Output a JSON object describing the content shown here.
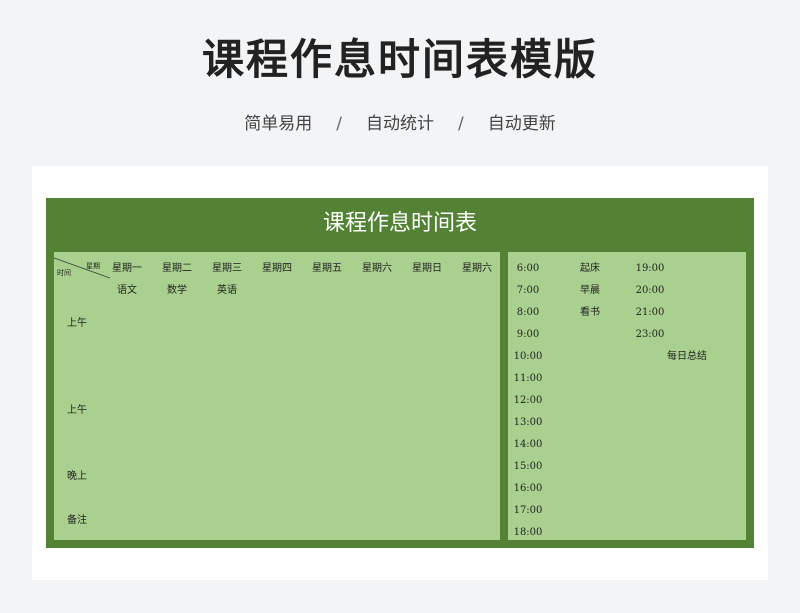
{
  "header": {
    "title": "课程作息时间表模版",
    "features": [
      "简单易用",
      "自动统计",
      "自动更新"
    ],
    "separator": "/"
  },
  "sheet": {
    "title": "课程作息时间表",
    "corner": {
      "top": "星期",
      "bottom": "时间"
    },
    "days": [
      "星期一",
      "星期二",
      "星期三",
      "星期四",
      "星期五",
      "星期六",
      "星期日",
      "星期六"
    ],
    "first_row": [
      "语文",
      "数学",
      "英语"
    ],
    "row_labels": [
      "上午",
      "上午",
      "晚上",
      "备注"
    ],
    "times": [
      "6:00",
      "7:00",
      "8:00",
      "9:00",
      "10:00",
      "11:00",
      "12:00",
      "13:00",
      "14:00",
      "15:00",
      "16:00",
      "17:00",
      "18:00"
    ],
    "activities": [
      "起床",
      "早晨",
      "看书"
    ],
    "evening_times": [
      "19:00",
      "20:00",
      "21:00",
      "23:00"
    ],
    "note": "每日总结"
  },
  "colors": {
    "sheet_green": "#548235",
    "panel_green": "#a9d08e",
    "background": "#f3f4f6"
  }
}
